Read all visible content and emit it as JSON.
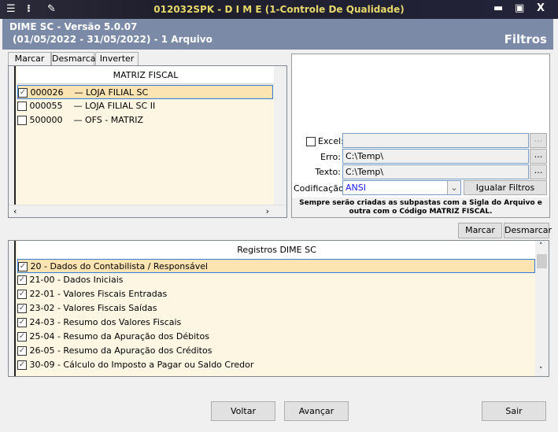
{
  "window": {
    "title": "012032SPK - D I M E (1-Controle De Qualidade)",
    "icons": [
      "menu-icon",
      "traffic-light-icon",
      "wrench-icon"
    ],
    "controls": [
      "minimize",
      "maximize",
      "close"
    ],
    "close_label": "X"
  },
  "header": {
    "line1": "DIME SC - Versão 5.0.07",
    "line2": "(01/05/2022 - 31/05/2022) - 1 Arquivo",
    "section": "Filtros",
    "color": "#7b8aa6"
  },
  "matriz": {
    "tabs": [
      "Marcar",
      "Desmarcar",
      "Inverter"
    ],
    "header": "MATRIZ FISCAL",
    "rows": [
      {
        "code": "000026",
        "name": "LOJA FILIAL SC",
        "checked": true,
        "selected": true
      },
      {
        "code": "000055",
        "name": "LOJA FILIAL SC II",
        "checked": false
      },
      {
        "code": "500000",
        "name": "OFS - MATRIZ",
        "checked": false
      }
    ]
  },
  "filters": {
    "excel_label": "Excel:",
    "excel_checked": false,
    "excel_value": "",
    "erro_label": "Erro:",
    "erro_value": "C:\\Temp\\",
    "texto_label": "Texto:",
    "texto_value": "C:\\Temp\\",
    "browse": "...",
    "cod_label": "Codificação:",
    "cod_value": "ANSI",
    "igualar": "Igualar Filtros",
    "note": "Sempre serão criadas as subpastas com a Sigla do Arquivo e outra com o Código MATRIZ FISCAL."
  },
  "registros": {
    "marcar": "Marcar",
    "desmarcar": "Desmarcar",
    "header": "Registros DIME SC",
    "rows": [
      "20 - Dados do Contabilista / Responsável",
      "21-00 - Dados Iniciais",
      "22-01 - Valores Fiscais Entradas",
      "23-02 - Valores Fiscais Saídas",
      "24-03 - Resumo dos Valores Fiscais",
      "25-04 - Resumo da Apuração dos Débitos",
      "26-05 - Resumo da Apuração dos Créditos",
      "30-09 - Cálculo do Imposto a Pagar ou Saldo Credor"
    ]
  },
  "footer": {
    "voltar": "Voltar",
    "avancar": "Avançar",
    "sair": "Sair"
  }
}
